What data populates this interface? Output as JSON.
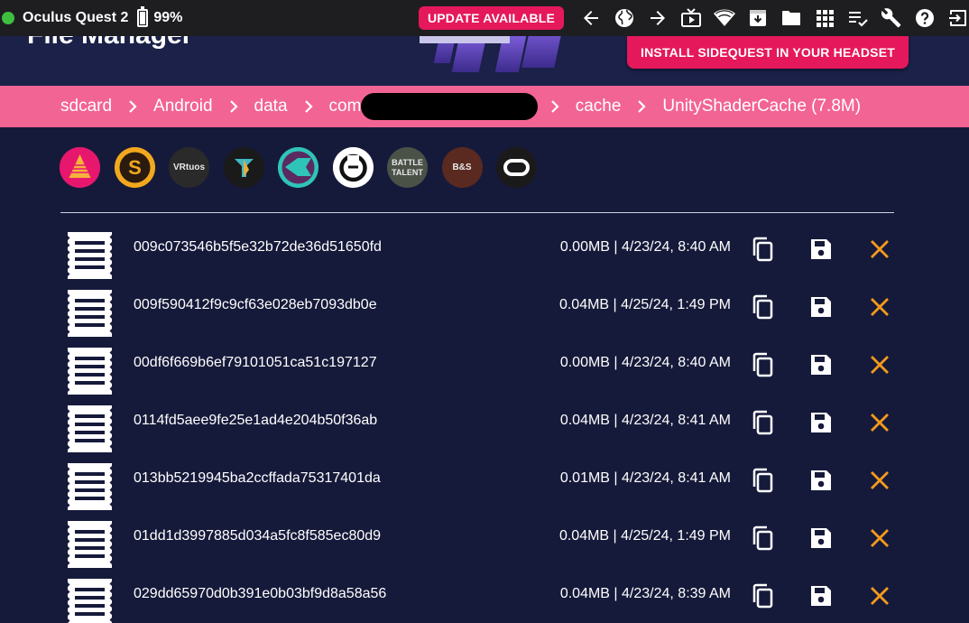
{
  "topbar": {
    "device_name": "Oculus Quest 2",
    "battery": "99%",
    "update_label": "UPDATE AVAILABLE",
    "icons": [
      "back-arrow-icon",
      "globe-icon",
      "forward-arrow-icon",
      "tv-icon",
      "wifi-icon",
      "download-box-icon",
      "folder-icon",
      "grid-icon",
      "checklist-icon",
      "wrench-icon",
      "help-icon",
      "exit-icon"
    ]
  },
  "header": {
    "title": "File Manager",
    "install_label": "INSTALL SIDEQUEST IN YOUR HEADSET"
  },
  "breadcrumb": {
    "items": [
      "sdcard",
      "Android",
      "data",
      "com.",
      "cache",
      "UnityShaderCache (7.8M)"
    ]
  },
  "apps": [
    {
      "name": "app-icon-1",
      "label": "",
      "bg": "#e8176e"
    },
    {
      "name": "app-icon-2",
      "label": "S",
      "bg": "#f2a81e"
    },
    {
      "name": "app-icon-vrtuos",
      "label": "VRtuos",
      "bg": "#2a2a2a"
    },
    {
      "name": "app-icon-4",
      "label": "",
      "bg": "#1a1a1a"
    },
    {
      "name": "app-icon-5",
      "label": "",
      "bg": "#2fc4b8"
    },
    {
      "name": "app-icon-6",
      "label": "",
      "bg": "#ffffff"
    },
    {
      "name": "app-icon-battle-talent",
      "label": "BATTLE TALENT",
      "bg": "#4a5248"
    },
    {
      "name": "app-icon-bs",
      "label": "B&S",
      "bg": "#5a2a20"
    },
    {
      "name": "app-icon-oculus",
      "label": "",
      "bg": "#1a1a1a"
    }
  ],
  "files": [
    {
      "name": "009c073546b5f5e32b72de36d51650fd",
      "meta": "0.00MB | 4/23/24, 8:40 AM"
    },
    {
      "name": "009f590412f9c9cf63e028eb7093db0e",
      "meta": "0.04MB | 4/25/24, 1:49 PM"
    },
    {
      "name": "00df6f669b6ef79101051ca51c197127",
      "meta": "0.00MB | 4/23/24, 8:40 AM"
    },
    {
      "name": "0114fd5aee9fe25e1ad4e204b50f36ab",
      "meta": "0.04MB | 4/23/24, 8:41 AM"
    },
    {
      "name": "013bb5219945ba2ccffada75317401da",
      "meta": "0.01MB | 4/23/24, 8:41 AM"
    },
    {
      "name": "01dd1d3997885d034a5fc8f585ec80d9",
      "meta": "0.04MB | 4/25/24, 1:49 PM"
    },
    {
      "name": "029dd65970d0b391e0b03bf9d8a58a56",
      "meta": "0.04MB | 4/23/24, 8:39 AM"
    }
  ],
  "colors": {
    "accent": "#e5185b",
    "breadcrumb_bg": "#f26494",
    "page_bg": "#161a3a",
    "delete": "#f59a1c"
  }
}
